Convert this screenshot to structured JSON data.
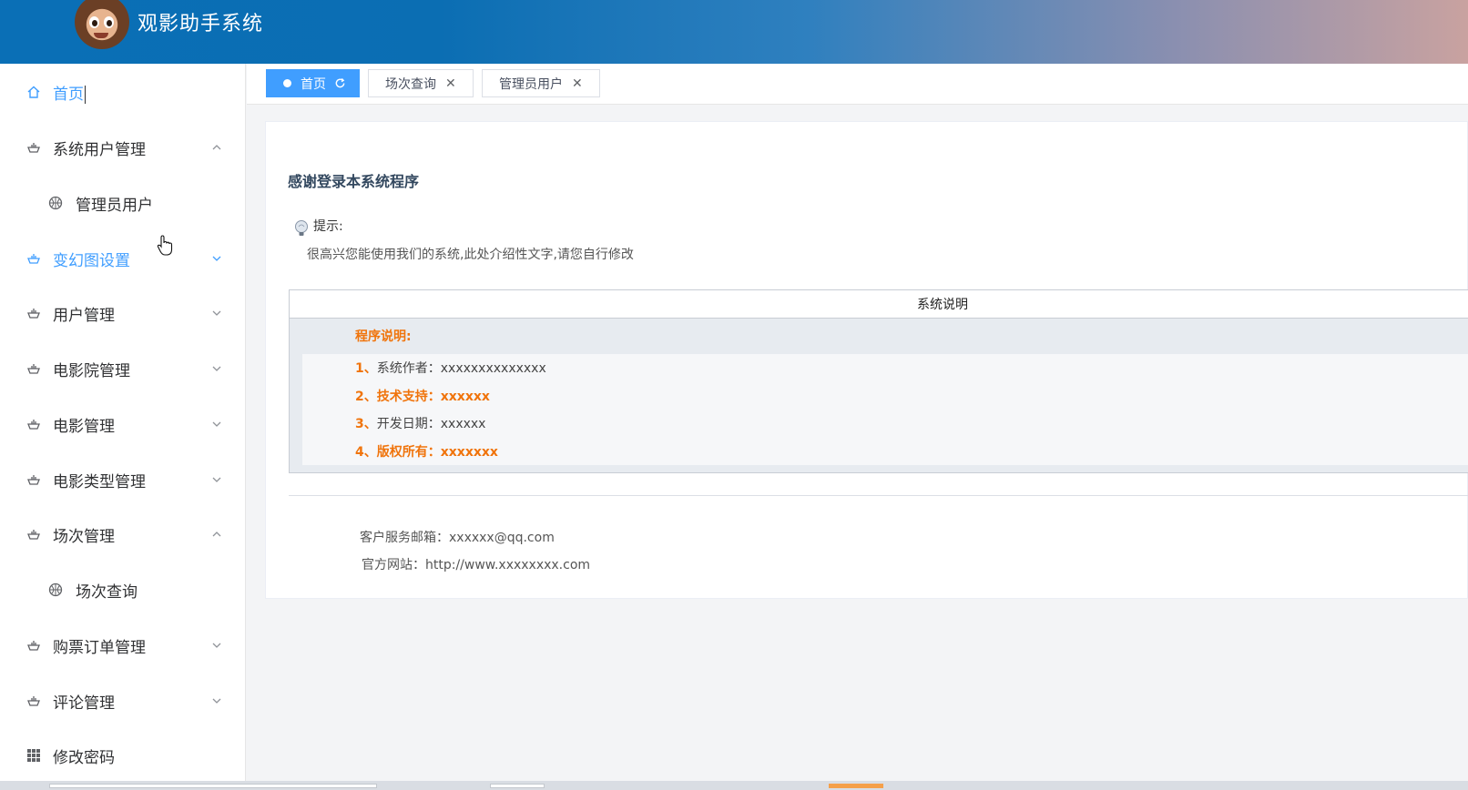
{
  "app": {
    "title": "观影助手系统"
  },
  "sidebar": {
    "items": [
      {
        "label": "首页",
        "icon": "home-icon",
        "active": true,
        "type": "item"
      },
      {
        "label": "系统用户管理",
        "icon": "cup-icon",
        "expanded": true,
        "type": "group"
      },
      {
        "label": "管理员用户",
        "icon": "basketball-icon",
        "type": "sub"
      },
      {
        "label": "变幻图设置",
        "icon": "cup-icon",
        "expanded": false,
        "type": "group",
        "hovered": true
      },
      {
        "label": "用户管理",
        "icon": "cup-icon",
        "expanded": false,
        "type": "group"
      },
      {
        "label": "电影院管理",
        "icon": "cup-icon",
        "expanded": false,
        "type": "group"
      },
      {
        "label": "电影管理",
        "icon": "cup-icon",
        "expanded": false,
        "type": "group"
      },
      {
        "label": "电影类型管理",
        "icon": "cup-icon",
        "expanded": false,
        "type": "group"
      },
      {
        "label": "场次管理",
        "icon": "cup-icon",
        "expanded": true,
        "type": "group"
      },
      {
        "label": "场次查询",
        "icon": "basketball-icon",
        "type": "sub"
      },
      {
        "label": "购票订单管理",
        "icon": "cup-icon",
        "expanded": false,
        "type": "group"
      },
      {
        "label": "评论管理",
        "icon": "cup-icon",
        "expanded": false,
        "type": "group"
      },
      {
        "label": "修改密码",
        "icon": "grid-icon",
        "type": "item"
      }
    ]
  },
  "tabs": [
    {
      "label": "首页",
      "active": true,
      "icon": "refresh-icon"
    },
    {
      "label": "场次查询",
      "active": false,
      "icon": "close-icon"
    },
    {
      "label": "管理员用户",
      "active": false,
      "icon": "close-icon"
    }
  ],
  "main": {
    "welcome": "感谢登录本系统程序",
    "tip_label": "提示:",
    "tip_text": "很高兴您能使用我们的系统,此处介绍性文字,请您自行修改",
    "table_header": "系统说明",
    "program_title": "程序说明:",
    "rows": [
      {
        "num": "1、",
        "text": "系统作者：xxxxxxxxxxxxxx",
        "highlight": false
      },
      {
        "num": "2、",
        "text": "技术支持：xxxxxx",
        "highlight": true
      },
      {
        "num": "3、",
        "text": " 开发日期：xxxxxx",
        "highlight": false
      },
      {
        "num": "4、",
        "text": "版权所有：xxxxxxx",
        "highlight": true
      }
    ],
    "email": "客户服务邮箱：xxxxxx@qq.com",
    "website": "官方网站：http://www.xxxxxxxx.com"
  },
  "colors": {
    "accent": "#409eff",
    "highlight": "#f0740c",
    "title": "#33485f"
  }
}
